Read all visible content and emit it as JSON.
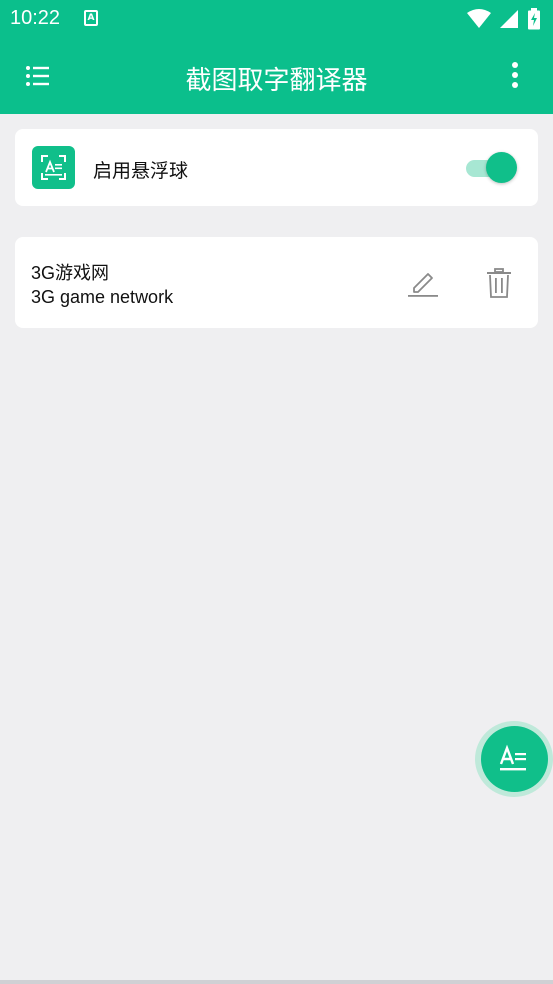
{
  "status_bar": {
    "time": "10:22",
    "notification_glyph": "A",
    "icons": [
      "wifi-icon",
      "signal-icon",
      "battery-charging-icon"
    ]
  },
  "app_bar": {
    "title": "截图取字翻译器",
    "left_icon": "menu-list-icon",
    "right_icon": "more-vertical-icon"
  },
  "float_ball_card": {
    "icon": "screenshot-text-icon",
    "label": "启用悬浮球",
    "enabled": true
  },
  "entries": [
    {
      "source": "3G游戏网",
      "translation": "3G game network",
      "actions": [
        "edit-icon",
        "delete-icon"
      ]
    }
  ],
  "fab": {
    "icon": "text-recognition-icon"
  },
  "colors": {
    "primary": "#0bbf8c",
    "background": "#efeff1",
    "card": "#ffffff",
    "switch_track": "#a7e7d3",
    "icon_gray": "#8a8a8a"
  }
}
